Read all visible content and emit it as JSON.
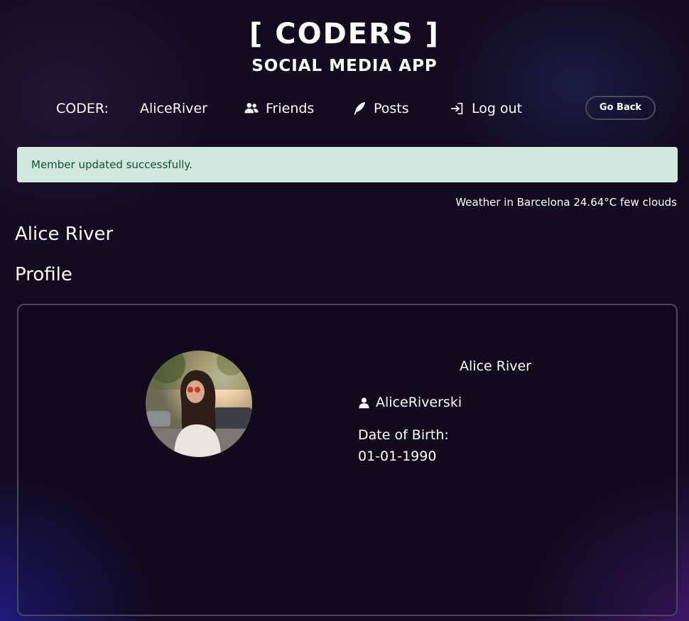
{
  "brand": {
    "title": "[ CODERS ]",
    "subtitle": "SOCIAL MEDIA APP"
  },
  "nav": {
    "coder_label": "CODER:",
    "username": "AliceRiver",
    "friends": {
      "label": "Friends",
      "icon": "friends-icon"
    },
    "posts": {
      "label": "Posts",
      "icon": "feather-icon"
    },
    "logout": {
      "label": "Log out",
      "icon": "logout-icon"
    },
    "go_back": "Go Back"
  },
  "alert": {
    "message": "Member updated successfully.",
    "bg_color": "#d1e7dd",
    "text_color": "#0f5132"
  },
  "weather": "Weather in Barcelona 24.64°C few clouds",
  "page": {
    "member_name": "Alice River",
    "section_title": "Profile"
  },
  "profile_card": {
    "full_name": "Alice River",
    "user_icon": "user-icon",
    "username": "AliceRiverski",
    "dob_label": "Date of Birth:",
    "dob_value": "01-01-1990"
  },
  "colors": {
    "background": "#130b20",
    "text": "#ffffff",
    "card_border": "#4a4757"
  }
}
